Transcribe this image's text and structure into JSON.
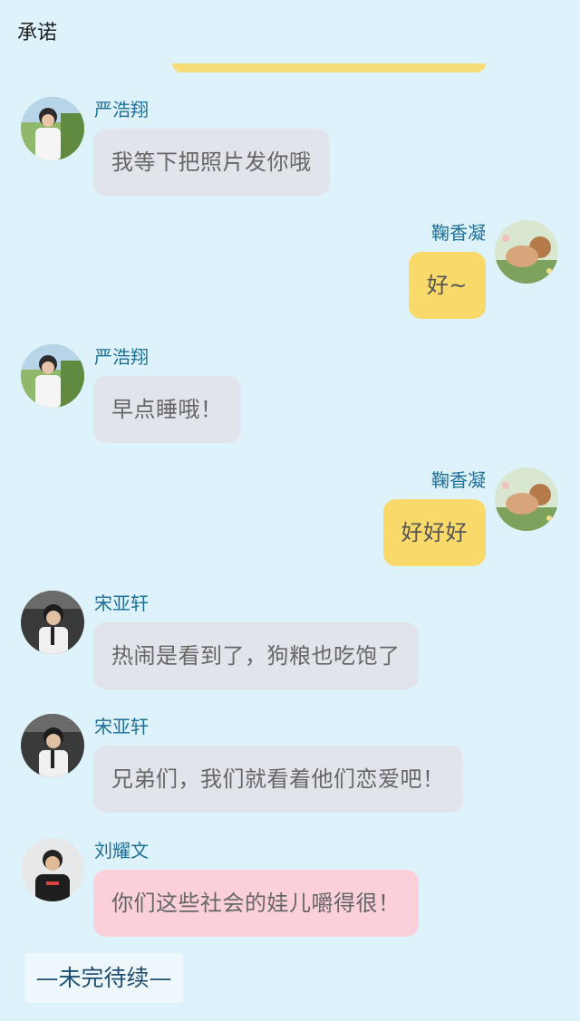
{
  "header": {
    "title": "承诺"
  },
  "messages": [
    {
      "side": "left",
      "sender": "严浩翔",
      "text": "我等下把照片发你哦",
      "bubble": "gray",
      "avatar": "avatar-yan-haoxiang"
    },
    {
      "side": "right",
      "sender": "鞠香凝",
      "text": "好~",
      "bubble": "yellow",
      "avatar": "avatar-ju-xiangning"
    },
    {
      "side": "left",
      "sender": "严浩翔",
      "text": "早点睡哦！",
      "bubble": "gray",
      "avatar": "avatar-yan-haoxiang"
    },
    {
      "side": "right",
      "sender": "鞠香凝",
      "text": "好好好",
      "bubble": "yellow",
      "avatar": "avatar-ju-xiangning"
    },
    {
      "side": "left",
      "sender": "宋亚轩",
      "text": "热闹是看到了，狗粮也吃饱了",
      "bubble": "gray",
      "avatar": "avatar-song-yaxuan"
    },
    {
      "side": "left",
      "sender": "宋亚轩",
      "text": "兄弟们，我们就看着他们恋爱吧！",
      "bubble": "gray",
      "avatar": "avatar-song-yaxuan"
    },
    {
      "side": "left",
      "sender": "刘耀文",
      "text": "你们这些社会的娃儿嚼得很！",
      "bubble": "pink",
      "avatar": "avatar-liu-yaowen"
    }
  ],
  "footer": {
    "text": "—未完待续—"
  },
  "colors": {
    "background": "#def2fb",
    "bubble_gray": "#e1e4ea",
    "bubble_yellow": "#fad96b",
    "bubble_pink": "#fcd0da",
    "name": "#1f6f9a"
  }
}
